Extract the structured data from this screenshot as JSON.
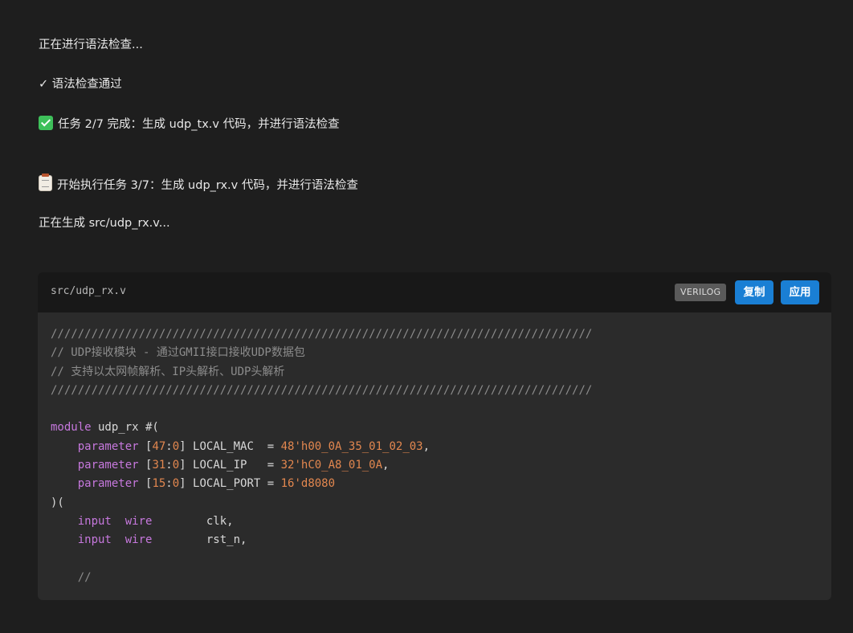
{
  "messages": {
    "syntax_checking": "正在进行语法检查...",
    "syntax_passed": "✓ 语法检查通过",
    "task2_done": "任务 2/7 完成：生成 udp_tx.v 代码，并进行语法检查",
    "task3_start": "开始执行任务 3/7：生成 udp_rx.v 代码，并进行语法检查",
    "generating": "正在生成 src/udp_rx.v..."
  },
  "icons": {
    "task2_done": "check-mark-button-icon",
    "task3_start": "clipboard-icon"
  },
  "code_block": {
    "filename": "src/udp_rx.v",
    "language": "VERILOG",
    "copy_label": "复制",
    "apply_label": "应用",
    "lines": [
      [
        {
          "t": "////////////////////////////////////////////////////////////////////////////////",
          "c": "comment"
        }
      ],
      [
        {
          "t": "// UDP接收模块 - 通过GMII接口接收UDP数据包",
          "c": "comment"
        }
      ],
      [
        {
          "t": "// 支持以太网帧解析、IP头解析、UDP头解析",
          "c": "comment"
        }
      ],
      [
        {
          "t": "////////////////////////////////////////////////////////////////////////////////",
          "c": "comment"
        }
      ],
      [],
      [
        {
          "t": "module",
          "c": "kw"
        },
        {
          "t": " udp_rx #(",
          "c": "plain"
        }
      ],
      [
        {
          "t": "    ",
          "c": "plain"
        },
        {
          "t": "parameter",
          "c": "kw"
        },
        {
          "t": " [",
          "c": "plain"
        },
        {
          "t": "47",
          "c": "num"
        },
        {
          "t": ":",
          "c": "plain"
        },
        {
          "t": "0",
          "c": "num"
        },
        {
          "t": "] LOCAL_MAC  = ",
          "c": "plain"
        },
        {
          "t": "48'h00_0A_35_01_02_03",
          "c": "num"
        },
        {
          "t": ",",
          "c": "plain"
        }
      ],
      [
        {
          "t": "    ",
          "c": "plain"
        },
        {
          "t": "parameter",
          "c": "kw"
        },
        {
          "t": " [",
          "c": "plain"
        },
        {
          "t": "31",
          "c": "num"
        },
        {
          "t": ":",
          "c": "plain"
        },
        {
          "t": "0",
          "c": "num"
        },
        {
          "t": "] LOCAL_IP   = ",
          "c": "plain"
        },
        {
          "t": "32'hC0_A8_01_0A",
          "c": "num"
        },
        {
          "t": ",",
          "c": "plain"
        }
      ],
      [
        {
          "t": "    ",
          "c": "plain"
        },
        {
          "t": "parameter",
          "c": "kw"
        },
        {
          "t": " [",
          "c": "plain"
        },
        {
          "t": "15",
          "c": "num"
        },
        {
          "t": ":",
          "c": "plain"
        },
        {
          "t": "0",
          "c": "num"
        },
        {
          "t": "] LOCAL_PORT = ",
          "c": "plain"
        },
        {
          "t": "16'd8080",
          "c": "num"
        }
      ],
      [
        {
          "t": ")(",
          "c": "plain"
        }
      ],
      [
        {
          "t": "    ",
          "c": "plain"
        },
        {
          "t": "input",
          "c": "kw"
        },
        {
          "t": "  ",
          "c": "plain"
        },
        {
          "t": "wire",
          "c": "kw"
        },
        {
          "t": "        clk,",
          "c": "plain"
        }
      ],
      [
        {
          "t": "    ",
          "c": "plain"
        },
        {
          "t": "input",
          "c": "kw"
        },
        {
          "t": "  ",
          "c": "plain"
        },
        {
          "t": "wire",
          "c": "kw"
        },
        {
          "t": "        rst_n,",
          "c": "plain"
        }
      ],
      [],
      [
        {
          "t": "    //",
          "c": "comment"
        }
      ]
    ]
  }
}
